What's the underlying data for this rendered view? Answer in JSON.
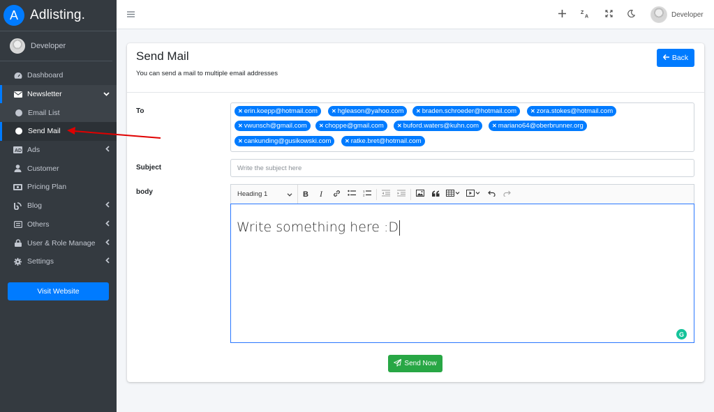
{
  "brand": {
    "logo_letter": "A",
    "name": "Adlisting."
  },
  "user": {
    "name": "Developer"
  },
  "sidebar": {
    "items": [
      {
        "label": "Dashboard",
        "icon": "dashboard-icon"
      },
      {
        "label": "Newsletter",
        "icon": "envelope-icon"
      },
      {
        "label": "Email List",
        "icon": "circle-icon"
      },
      {
        "label": "Send Mail",
        "icon": "circle-icon"
      },
      {
        "label": "Ads",
        "icon": "ad-icon"
      },
      {
        "label": "Customer",
        "icon": "user-icon"
      },
      {
        "label": "Pricing Plan",
        "icon": "money-icon"
      },
      {
        "label": "Blog",
        "icon": "blog-icon"
      },
      {
        "label": "Others",
        "icon": "list-icon"
      },
      {
        "label": "User & Role Manage",
        "icon": "lock-icon"
      },
      {
        "label": "Settings",
        "icon": "gear-icon"
      }
    ],
    "visit_website": "Visit Website"
  },
  "topbar": {
    "user_name": "Developer"
  },
  "page": {
    "title": "Send Mail",
    "subtitle": "You can send a mail to multiple email addresses",
    "back_label": "Back"
  },
  "form": {
    "to_label": "To",
    "recipients": [
      "erin.koepp@hotmail.com",
      "hgleason@yahoo.com",
      "braden.schroeder@hotmail.com",
      "zora.stokes@hotmail.com",
      "vwunsch@gmail.com",
      "choppe@gmail.com",
      "buford.waters@kuhn.com",
      "mariano64@oberbrunner.org",
      "cankunding@gusikowski.com",
      "ratke.bret@hotmail.com"
    ],
    "subject_label": "Subject",
    "subject_placeholder": "Write the subject here",
    "body_label": "body",
    "heading_select": "Heading 1",
    "body_text": "Write something here :D",
    "send_label": "Send Now"
  },
  "colors": {
    "primary": "#007bff",
    "success": "#28a745",
    "sidebar_bg": "#343a40",
    "annotation_arrow": "#e00000"
  }
}
